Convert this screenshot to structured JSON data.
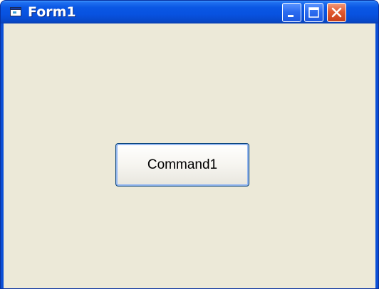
{
  "window": {
    "title": "Form1",
    "icon": "form-window-icon",
    "controls": {
      "minimize_icon": "minimize-icon",
      "maximize_icon": "maximize-icon",
      "close_icon": "close-icon"
    }
  },
  "form": {
    "command_button_label": "Command1"
  },
  "colors": {
    "titlebar": "#0852e0",
    "client_background": "#ece9d8",
    "close_button": "#e25a30",
    "button_border": "#003c74"
  }
}
